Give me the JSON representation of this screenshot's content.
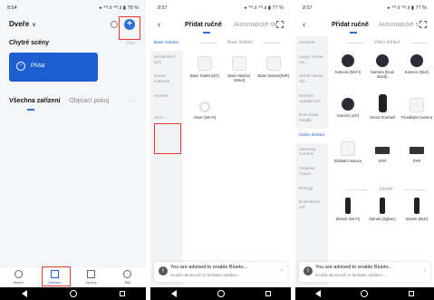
{
  "screen1": {
    "status": {
      "time": "8:54",
      "right": "▸ ⁴ᴳ.ıl ⁴ᴳ.ıl ▮ 78 %"
    },
    "home_title": "Dveře",
    "scenes_title": "Chytré scény",
    "scenes_more": "Více",
    "scene_card_label": "Přidat",
    "device_tab_all": "Všechna zařízení",
    "device_tab_rooms": "Objivací pokoj",
    "device_tab_more": "···",
    "bottom_tabs": [
      "Hlavní",
      "Zařízení",
      "Zprávy",
      "Můj"
    ]
  },
  "screen2": {
    "status": {
      "time": "8:57",
      "right": "▸ ⁴ᴳ.ıl ⁴ᴳ.ıl ▮ 77 %"
    },
    "tab_manual": "Přidat ručně",
    "tab_auto": "Automatické sk",
    "categories": [
      "Base Station",
      "Sensors/Al arm",
      "Smart Camera",
      "Access",
      "Více..."
    ],
    "section_title": "Base Station",
    "devices": [
      {
        "name": "Base Station(4G)"
      },
      {
        "name": "Base Station( Wired)"
      },
      {
        "name": "Base Station(WiFi)"
      },
      {
        "name": "Alarm (Wi-Fi)"
      }
    ],
    "bt_title": "You are advised to enable Blueto...",
    "bt_sub": "Enable Bluetooth to facilitate addition ..."
  },
  "screen3": {
    "status": {
      "time": "8:57",
      "right": "▸ ⁴ᴳ.ıl ⁴ᴳ.ıl ▮ 77 %"
    },
    "tab_manual": "Přidat ručně",
    "tab_auto": "Automatické s",
    "categories": [
      "Sensors",
      "Large Home Ap...",
      "Small Home Ap...",
      "Kitchen Appliances",
      "Exercise& Health",
      "Video dohled",
      "Gateway Control",
      "Outdoor Travel",
      "Energy",
      "Entertainm ent"
    ],
    "section_video": "Video dohled",
    "video_devices": [
      {
        "name": "Kamera (Wi-Fi)"
      },
      {
        "name": "Kamera (Dual Band)"
      },
      {
        "name": "Kamera (BLE)"
      },
      {
        "name": "Kamera (4G)"
      },
      {
        "name": "Smart Doorbell"
      },
      {
        "name": "Floodlight Camera"
      },
      {
        "name": "Základní stanice"
      },
      {
        "name": "NVR"
      },
      {
        "name": "DVR"
      }
    ],
    "section_lock": "Zámek",
    "lock_devices": [
      {
        "name": "Zámek (Wi-Fi)"
      },
      {
        "name": "Zámek (Zigbee)"
      },
      {
        "name": "Zámek (BLE)"
      }
    ],
    "bt_title": "You are advised to enable Blueto...",
    "bt_sub": "Enable Bluetooth to facilitate addition ..."
  },
  "colors": {
    "accent": "#1d5fd0",
    "highlight": "#e53935",
    "category_bg": "#f2f3f5"
  }
}
